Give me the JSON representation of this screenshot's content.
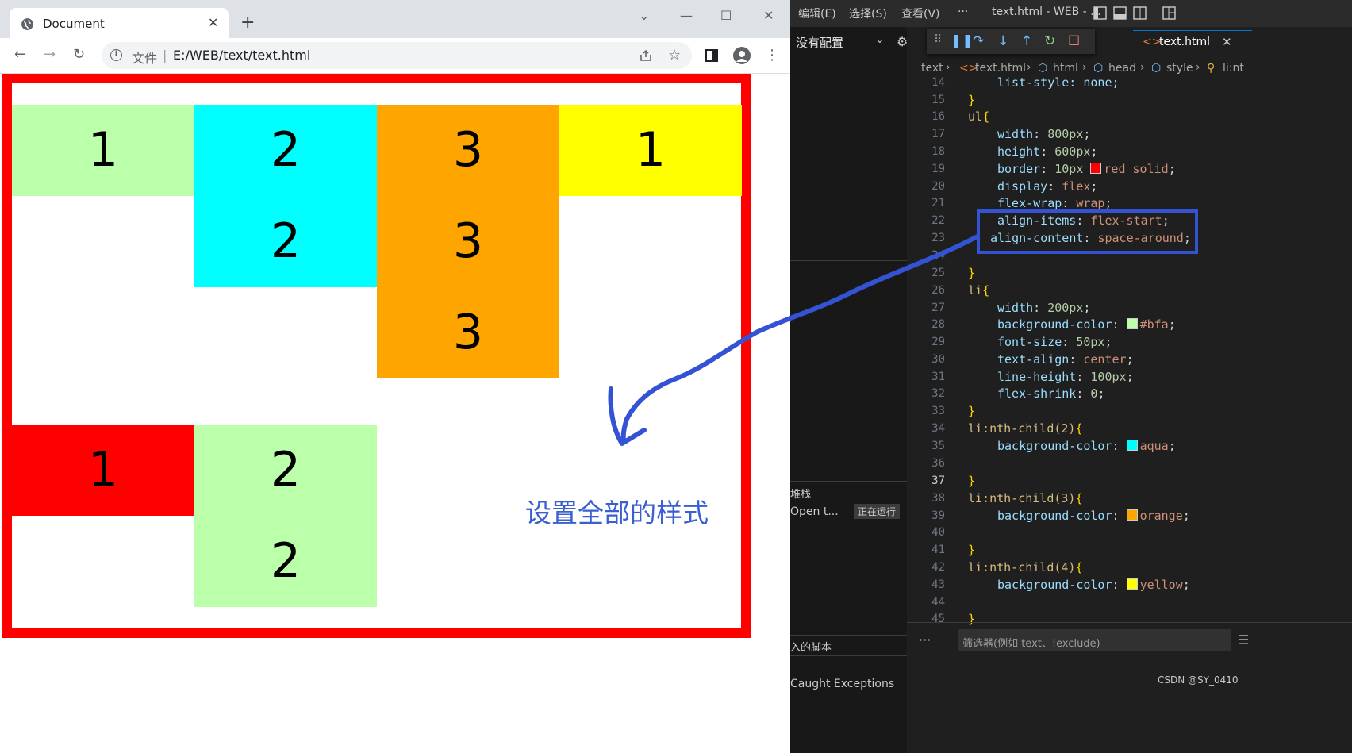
{
  "browser": {
    "tab_title": "Document",
    "tab_close": "✕",
    "new_tab": "+",
    "window_controls": [
      "⌄",
      "—",
      "☐",
      "✕"
    ],
    "nav": {
      "back": "←",
      "forward": "→",
      "reload": "↻"
    },
    "address_label": "文件",
    "address_sep": "|",
    "address_url": "E:/WEB/text/text.html",
    "toolbar_icons": [
      "share-icon",
      "star-icon",
      "sidepanel-icon",
      "profile-icon",
      "menu-icon"
    ]
  },
  "page": {
    "ul_border_color": "#ff0000",
    "items": [
      {
        "label": "1",
        "rows": [
          "1"
        ],
        "color": "#bbffaa"
      },
      {
        "label": "2",
        "rows": [
          "2",
          "2"
        ],
        "color": "#00ffff"
      },
      {
        "label": "3",
        "rows": [
          "3",
          "3",
          "3"
        ],
        "color": "#ffa500"
      },
      {
        "label": "1",
        "rows": [
          "1"
        ],
        "color": "#ffff00"
      },
      {
        "label": "1",
        "rows": [
          "1"
        ],
        "color": "#ff0000"
      },
      {
        "label": "2",
        "rows": [
          "2",
          "2"
        ],
        "color": "#bbffaa"
      }
    ],
    "annotation": "设置全部的样式",
    "annotation_color": "#3a5fd0"
  },
  "editor": {
    "menu": [
      "编辑(E)",
      "选择(S)",
      "查看(V)",
      "···"
    ],
    "window_title": "text.html - WEB - ...",
    "config_label": "没有配置",
    "file_tab": "text.html",
    "file_tab_close": "✕",
    "breadcrumbs": [
      "text",
      "text.html",
      "html",
      "head",
      "style",
      "li:nt"
    ],
    "line_numbers": [
      "14",
      "15",
      "16",
      "17",
      "18",
      "19",
      "20",
      "21",
      "22",
      "23",
      "24",
      "25",
      "26",
      "27",
      "28",
      "29",
      "30",
      "31",
      "32",
      "33",
      "34",
      "35",
      "36",
      "37",
      "38",
      "39",
      "40",
      "41",
      "42",
      "43",
      "44",
      "45"
    ],
    "code": {
      "l14": "list-style: none;",
      "l15": "}",
      "l16_sel": "ul",
      "l17": [
        "width",
        "800px"
      ],
      "l18": [
        "height",
        "600px"
      ],
      "l19": [
        "border",
        "10px",
        "red solid"
      ],
      "l20": [
        "display",
        "flex"
      ],
      "l21": [
        "flex-wrap",
        "wrap"
      ],
      "l22": [
        "align-items",
        "flex-start"
      ],
      "l23": [
        "align-content",
        "space-around"
      ],
      "l25": "}",
      "l26_sel": "li",
      "l27": [
        "width",
        "200px"
      ],
      "l28": [
        "background-color",
        "#bfa"
      ],
      "l29": [
        "font-size",
        "50px"
      ],
      "l30": [
        "text-align",
        "center"
      ],
      "l31": [
        "line-height",
        "100px"
      ],
      "l32": [
        "flex-shrink",
        "0"
      ],
      "l33": "}",
      "l34_sel": "li:nth-child(2)",
      "l35": [
        "background-color",
        "aqua"
      ],
      "l37": "}",
      "l38_sel": "li:nth-child(3)",
      "l39": [
        "background-color",
        "orange"
      ],
      "l41": "}",
      "l42_sel": "li:nth-child(4)",
      "l43": [
        "background-color",
        "yellow"
      ],
      "l45": "}"
    },
    "swatches": {
      "red": "#ff0000",
      "bfa": "#bbffaa",
      "aqua": "#00ffff",
      "orange": "#ffa500",
      "yellow": "#ffff00"
    },
    "debug_panel": {
      "stack_title": "堆栈",
      "stack_item": "Open t...",
      "stack_badge": "正在运行",
      "scripts_title": "入的脚本",
      "exceptions": "Caught Exceptions",
      "filter_placeholder": "筛选器(例如 text、!exclude)",
      "filter_dots": "···",
      "filter_menu": "☰"
    },
    "watermark": "CSDN @SY_0410",
    "highlight_color": "#3352d4"
  }
}
